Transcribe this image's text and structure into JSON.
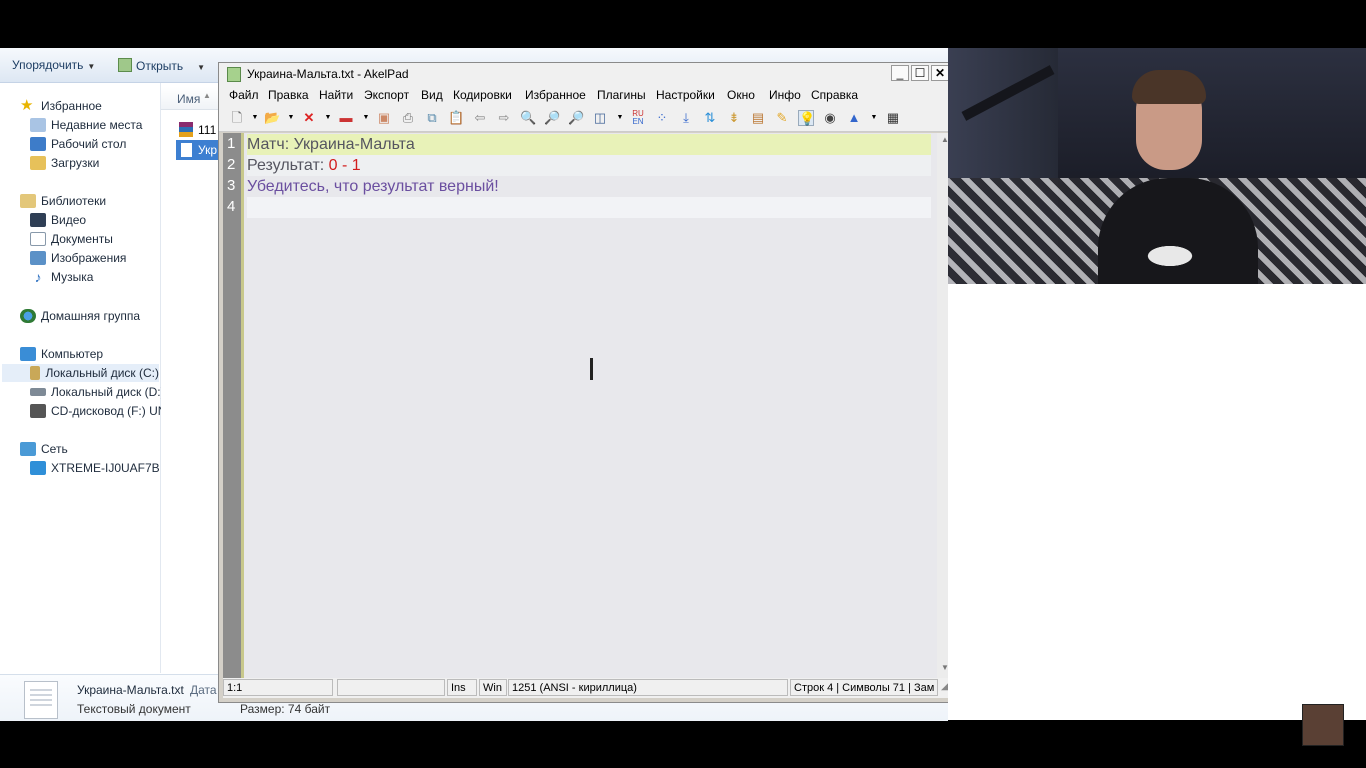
{
  "explorer": {
    "toolbar": {
      "organize_label": "Упорядочить",
      "open_label": "Открыть"
    },
    "nav": {
      "favorites": "Избранное",
      "recent_places": "Недавние места",
      "desktop": "Рабочий стол",
      "downloads": "Загрузки",
      "libraries": "Библиотеки",
      "video": "Видео",
      "documents": "Документы",
      "images": "Изображения",
      "music": "Музыка",
      "homegroup": "Домашняя группа",
      "computer": "Компьютер",
      "disk_c": "Локальный диск (C:)",
      "disk_d": "Локальный диск (D:)",
      "cd_drive": "CD-дисковод (F:) UN",
      "network": "Сеть",
      "network_pc": "XTREME-IJ0UAF7B"
    },
    "filelist": {
      "column_name": "Имя",
      "file1": "111",
      "file2": "Укр"
    },
    "details": {
      "filename": "Украина-Мальта.txt",
      "date_label": "Дата",
      "filetype": "Текстовый документ",
      "size": "Размер: 74 байт"
    }
  },
  "akelpad": {
    "title": "Украина-Мальта.txt - AkelPad",
    "menu": [
      "Файл",
      "Правка",
      "Найти",
      "Экспорт",
      "Вид",
      "Кодировки",
      "Избранное",
      "Плагины",
      "Настройки",
      "Окно",
      "Инфо",
      "Справка"
    ],
    "editor": {
      "line_numbers": [
        "1",
        "2",
        "3",
        "4"
      ],
      "line1": "Матч: Украина-Мальта",
      "line2_prefix": "Результат: ",
      "line2_score_a": "0",
      "line2_sep": " - ",
      "line2_score_b": "1",
      "line3": "Убедитесь, что результат верный!",
      "line4": ""
    },
    "status": {
      "position": "1:1",
      "insert_mode": "Ins",
      "newline": "Win",
      "encoding": "1251  (ANSI - кириллица)",
      "stats": "Строк 4 | Символы 71 | Зам"
    },
    "colors": {
      "highlight_line": "#e8f2b8",
      "score_red": "#d21e1e",
      "line3_purple": "#6b4fa0"
    }
  }
}
